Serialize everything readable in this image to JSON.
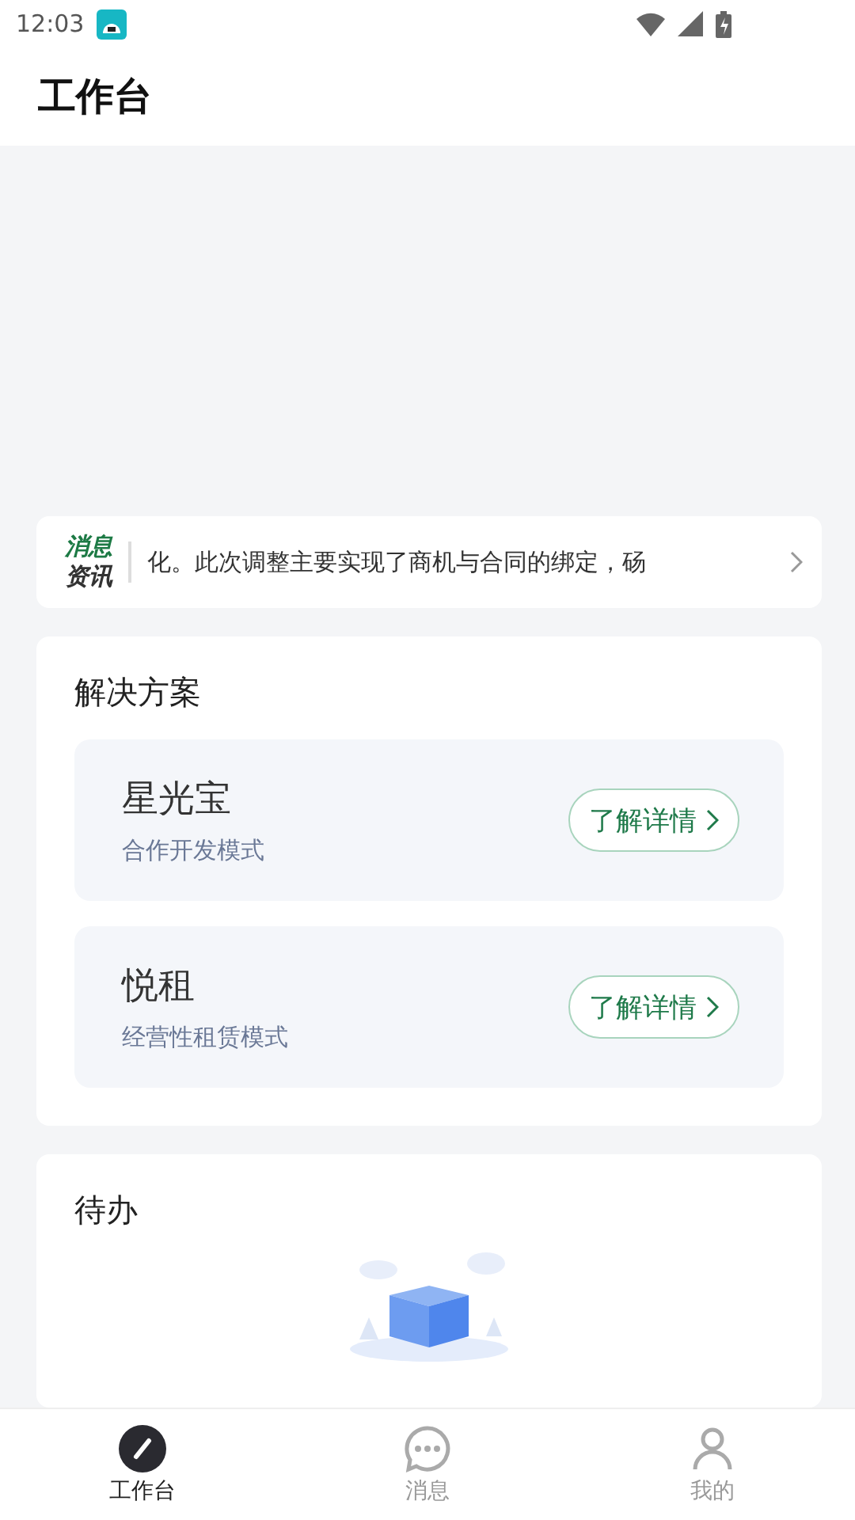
{
  "status_bar": {
    "time": "12:03"
  },
  "header": {
    "title": "工作台"
  },
  "news": {
    "label_top": "消息",
    "label_bottom": "资讯",
    "text": "化。此次调整主要实现了商机与合同的绑定，砀"
  },
  "solutions": {
    "title": "解决方案",
    "items": [
      {
        "name": "星光宝",
        "subtitle": "合作开发模式",
        "action": "了解详情"
      },
      {
        "name": "悦租",
        "subtitle": "经营性租赁模式",
        "action": "了解详情"
      }
    ]
  },
  "todo": {
    "title": "待办"
  },
  "tabs": [
    {
      "label": "工作台",
      "kind": "work",
      "selected": true
    },
    {
      "label": "消息",
      "kind": "message",
      "selected": false
    },
    {
      "label": "我的",
      "kind": "profile",
      "selected": false
    }
  ]
}
